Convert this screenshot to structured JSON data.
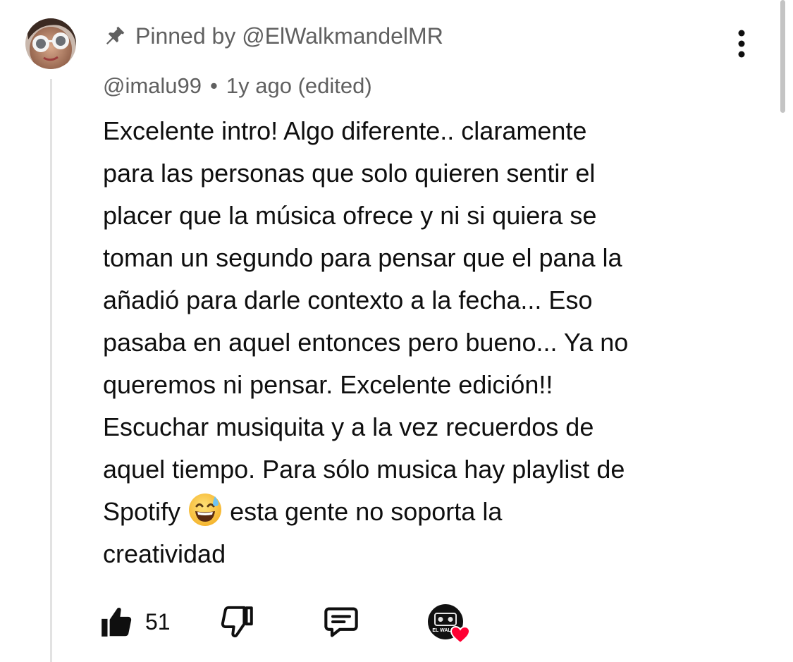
{
  "comment": {
    "pinned_label": "Pinned by @ElWalkmandelMR",
    "author": "@imalu99",
    "separator": "•",
    "timestamp": "1y ago (edited)",
    "body_part1": "Excelente intro! Algo diferente.. claramente\npara las personas que solo quieren sentir el\nplacer que la música ofrece y ni si quiera se\ntoman un segundo para pensar que el pana la\nañadió para darle contexto a la fecha... Eso\npasaba en aquel entonces pero bueno... Ya no\nqueremos ni pensar. Excelente edición!!\nEscuchar musiquita y a la vez recuerdos de\naquel tiempo. Para sólo musica hay playlist de\nSpotify ",
    "emoji_icon": "grinning-face-with-sweat-icon",
    "body_part2": " esta gente no soporta la\ncreatividad",
    "like_count": "51",
    "creator_logo_text": "EL WALKM"
  },
  "icons": {
    "pin": "pin-icon",
    "more": "more-vertical-icon",
    "like": "thumbs-up-icon",
    "dislike": "thumbs-down-icon",
    "reply": "reply-comment-icon",
    "heart": "heart-icon"
  },
  "colors": {
    "text": "#0f0f0f",
    "secondary_text": "#606060",
    "heart": "#ff0033",
    "thread_line": "#e2e2e2"
  }
}
